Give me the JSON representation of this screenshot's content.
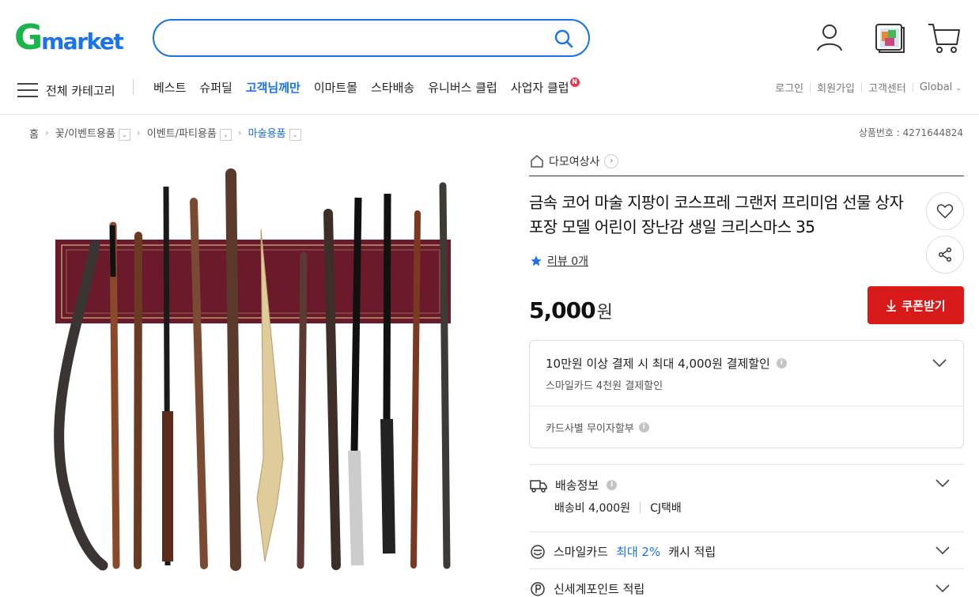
{
  "header": {
    "logo_g": "G",
    "logo_rest": "market",
    "search_placeholder": "",
    "icons": [
      "search-icon",
      "user-icon",
      "recent-items-icon",
      "cart-icon"
    ]
  },
  "nav": {
    "all_category": "전체 카테고리",
    "items": [
      "베스트",
      "슈퍼딜",
      "고객님께만",
      "이마트몰",
      "스타배송",
      "유니버스 클럽",
      "사업자 클럽"
    ],
    "new_badge": "N",
    "util": [
      "로그인",
      "회원가입",
      "고객센터",
      "Global"
    ]
  },
  "breadcrumb": [
    "홈",
    "꽃/이벤트용품",
    "이벤트/파티용품",
    "마술용품"
  ],
  "product_no": "상품번호 : 4271644824",
  "seller": "다모여상사",
  "title": "금속 코어 마술 지팡이 코스프레 그랜저 프리미엄 선물 상자 포장 모델 어린이 장난감 생일 크리스마스 35",
  "review": "리뷰 0개",
  "price": {
    "amount": "5,000",
    "unit": "원"
  },
  "coupon_label": "쿠폰받기",
  "discount": {
    "main": "10만원 이상 결제 시 최대 4,000원 결제할인",
    "sub": "스마일카드 4천원 결제할인",
    "card": "카드사별 무이자할부"
  },
  "shipping": {
    "label": "배송정보",
    "fee": "배송비 4,000원",
    "carrier": "CJ택배"
  },
  "smilecard": {
    "prefix": "스마일카드",
    "highlight": "최대 2%",
    "suffix": "캐시 적립"
  },
  "points": "신세계포인트 적립",
  "colors": {
    "brand_green": "#1ab44a",
    "brand_blue": "#1a73e8",
    "coupon_red": "#d91a1a"
  }
}
